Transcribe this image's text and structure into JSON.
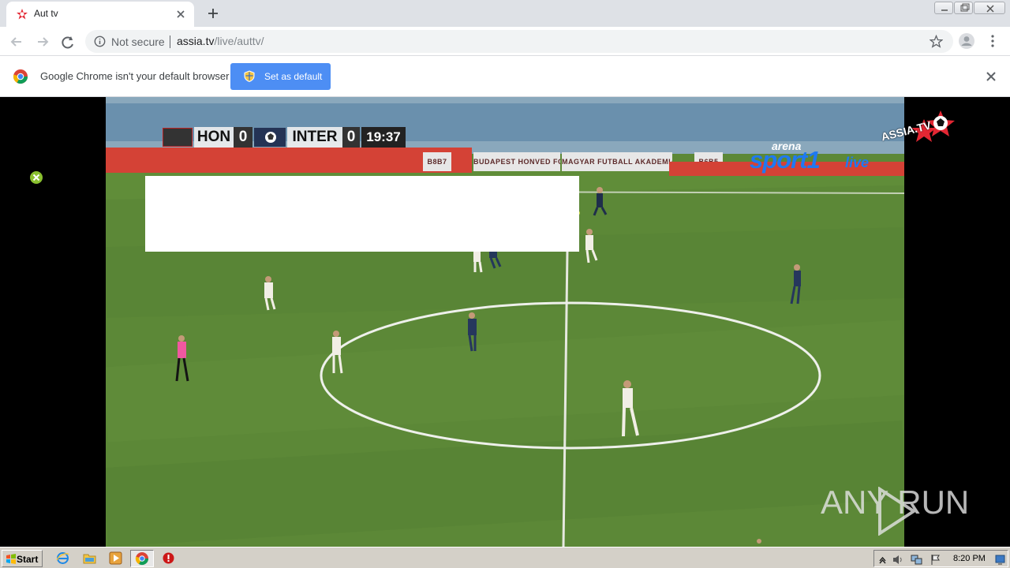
{
  "browser": {
    "tab_title": "Aut tv",
    "window_controls": [
      "minimize",
      "maximize",
      "close"
    ],
    "security_label": "Not secure",
    "url_host": "assia.tv",
    "url_path": "/live/auttv/"
  },
  "infobar": {
    "message": "Google Chrome isn't your default browser",
    "button_label": "Set as default"
  },
  "video": {
    "home_team": "HON",
    "home_score": "0",
    "away_team": "INTER",
    "away_score": "0",
    "match_time": "19:37",
    "boards": [
      "BUDAPEST HONVED FC",
      "MAGYAR FUTBALL AKADEMIA",
      "B6B5",
      "B8B7"
    ],
    "broadcaster_top": "arena",
    "broadcaster_main": "sport1",
    "broadcaster_live": "live",
    "site_logo": "ASSIA.TV",
    "watermark": "ANY RUN"
  },
  "taskbar": {
    "start_label": "Start",
    "time": "8:20 PM"
  },
  "colors": {
    "chrome_blue": "#4d8ef4",
    "pitch_green": "#5c8837",
    "home_red": "#d44236",
    "sport_blue": "#1f79f2"
  },
  "icons": {
    "tab": "assia-favicon",
    "close": "close-icon",
    "new_tab": "plus-icon",
    "security": "info-icon",
    "bookmark": "star-icon",
    "profile": "avatar-icon",
    "menu": "menu-icon"
  }
}
